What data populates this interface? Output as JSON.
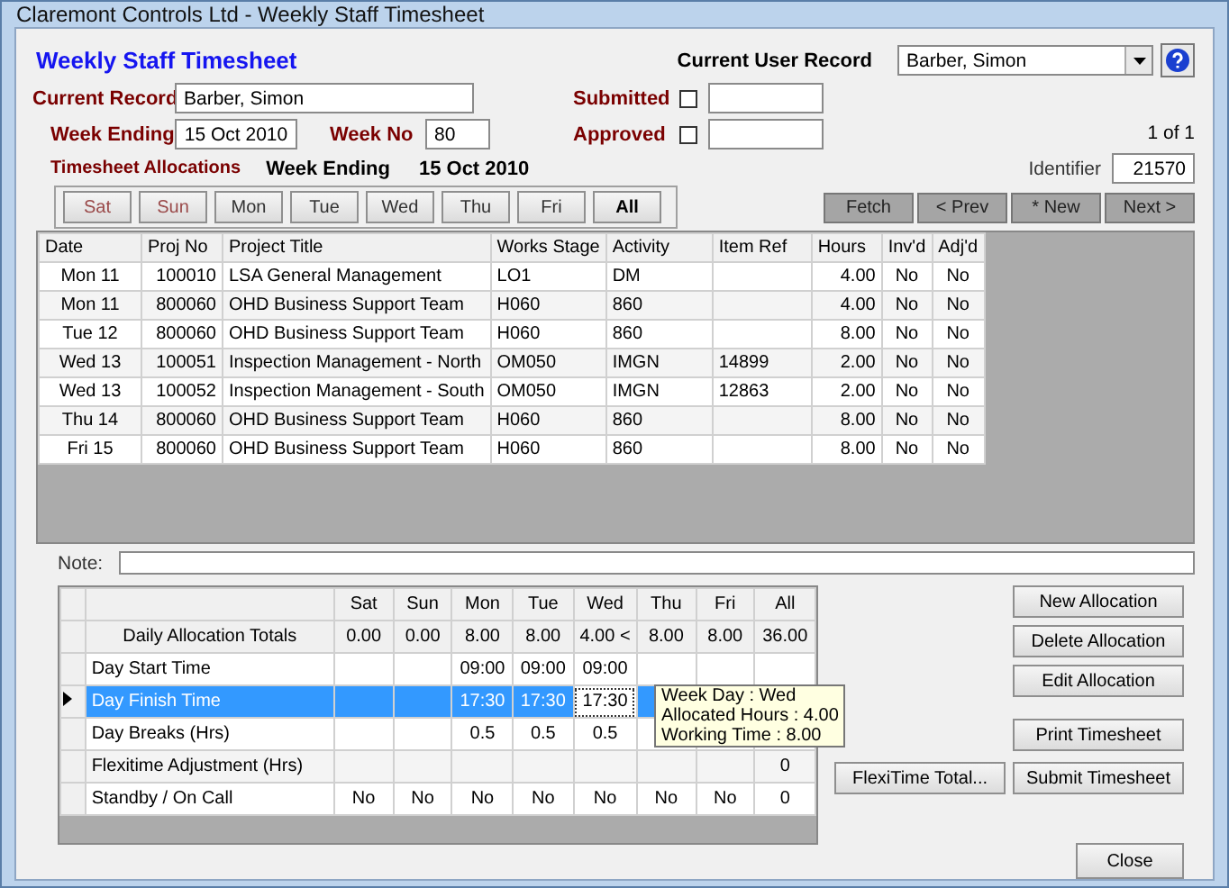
{
  "window": {
    "title": "Claremont Controls Ltd - Weekly Staff Timesheet"
  },
  "heading": "Weekly Staff Timesheet",
  "current_user": {
    "label": "Current User Record",
    "value": "Barber, Simon"
  },
  "form": {
    "current_record": {
      "label": "Current Record",
      "value": "Barber, Simon"
    },
    "week_ending": {
      "label": "Week Ending",
      "value": "15 Oct 2010"
    },
    "week_no": {
      "label": "Week No",
      "value": "80"
    },
    "submitted": {
      "label": "Submitted",
      "checked": false
    },
    "approved": {
      "label": "Approved",
      "checked": false
    }
  },
  "record_count": "1 of 1",
  "identifier": {
    "label": "Identifier",
    "value": "21570"
  },
  "allocations": {
    "label": "Timesheet Allocations",
    "week_ending_label": "Week Ending",
    "week_ending": "15 Oct 2010"
  },
  "day_filters": [
    {
      "label": "Sat",
      "weekend": true,
      "selected": false
    },
    {
      "label": "Sun",
      "weekend": true,
      "selected": false
    },
    {
      "label": "Mon",
      "weekend": false,
      "selected": false
    },
    {
      "label": "Tue",
      "weekend": false,
      "selected": false
    },
    {
      "label": "Wed",
      "weekend": false,
      "selected": false
    },
    {
      "label": "Thu",
      "weekend": false,
      "selected": false
    },
    {
      "label": "Fri",
      "weekend": false,
      "selected": false
    },
    {
      "label": "All",
      "weekend": false,
      "selected": true
    }
  ],
  "nav_buttons": [
    "Fetch",
    "< Prev",
    "* New",
    "Next >"
  ],
  "table": {
    "columns": [
      "Date",
      "Proj No",
      "Project Title",
      "Works Stage",
      "Activity",
      "Item Ref",
      "Hours",
      "Inv'd",
      "Adj'd"
    ],
    "rows": [
      [
        "Mon 11",
        "100010",
        "LSA General Management",
        "LO1",
        "DM",
        null,
        "4.00",
        "No",
        "No"
      ],
      [
        "Mon 11",
        "800060",
        "OHD Business Support Team",
        "H060",
        "860",
        null,
        "4.00",
        "No",
        "No"
      ],
      [
        "Tue 12",
        "800060",
        "OHD Business Support Team",
        "H060",
        "860",
        null,
        "8.00",
        "No",
        "No"
      ],
      [
        "Wed 13",
        "100051",
        "Inspection Management - North",
        "OM050",
        "IMGN",
        "14899",
        "2.00",
        "No",
        "No"
      ],
      [
        "Wed 13",
        "100052",
        "Inspection Management - South",
        "OM050",
        "IMGN",
        "12863",
        "2.00",
        "No",
        "No"
      ],
      [
        "Thu 14",
        "800060",
        "OHD Business Support Team",
        "H060",
        "860",
        null,
        "8.00",
        "No",
        "No"
      ],
      [
        "Fri 15",
        "800060",
        "OHD Business Support Team",
        "H060",
        "860",
        null,
        "8.00",
        "No",
        "No"
      ]
    ]
  },
  "note": {
    "label": "Note:"
  },
  "daily_grid": {
    "columns": [
      "Sat",
      "Sun",
      "Mon",
      "Tue",
      "Wed",
      "Thu",
      "Fri",
      "All"
    ],
    "totals": {
      "label": "Daily Allocation Totals",
      "cells": [
        "0.00",
        "0.00",
        "8.00",
        "8.00",
        "4.00 <",
        "8.00",
        "8.00",
        "36.00"
      ]
    },
    "rows": [
      {
        "label": "Day Start Time",
        "selected": false,
        "cells": [
          null,
          null,
          "09:00",
          "09:00",
          "09:00",
          null,
          null,
          null
        ]
      },
      {
        "label": "Day Finish Time",
        "selected": true,
        "cells": [
          null,
          null,
          "17:30",
          "17:30",
          "17:30",
          null,
          null,
          null
        ]
      },
      {
        "label": "Day Breaks (Hrs)",
        "selected": false,
        "cells": [
          null,
          null,
          "0.5",
          "0.5",
          "0.5",
          null,
          null,
          null
        ]
      },
      {
        "label": "Flexitime Adjustment (Hrs)",
        "selected": false,
        "cells": [
          null,
          null,
          null,
          null,
          null,
          null,
          null,
          "0"
        ]
      },
      {
        "label": "Standby / On Call",
        "selected": false,
        "cells": [
          "No",
          "No",
          "No",
          "No",
          "No",
          "No",
          "No",
          "0"
        ]
      }
    ],
    "tooltip": [
      "Week Day : Wed",
      "Allocated Hours : 4.00",
      "Working Time : 8.00"
    ]
  },
  "action_buttons": [
    "New Allocation",
    "Delete Allocation",
    "Edit Allocation",
    "Print Timesheet"
  ],
  "flexitime_button": "FlexiTime Total...",
  "submit_button": "Submit Timesheet",
  "close_button": "Close"
}
